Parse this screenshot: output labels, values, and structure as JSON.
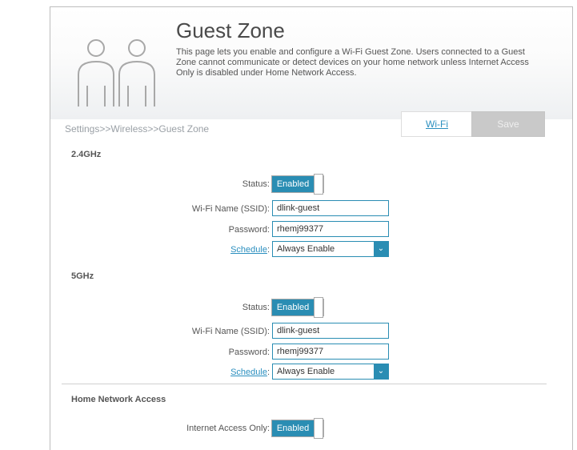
{
  "header": {
    "title": "Guest Zone",
    "description": "This page lets you enable and configure a Wi-Fi Guest Zone. Users connected to a Guest Zone cannot communicate or detect devices on your home network unless Internet Access Only is disabled under Home Network Access."
  },
  "breadcrumb": "Settings>>Wireless>>Guest Zone",
  "toolbar": {
    "wifi_label": "Wi-Fi",
    "save_label": "Save"
  },
  "band_24": {
    "title": "2.4GHz",
    "status_label": "Status:",
    "status_value": "Enabled",
    "ssid_label": "Wi-Fi Name (SSID):",
    "ssid_value": "dlink-guest",
    "password_label": "Password:",
    "password_value": "rhemj99377",
    "schedule_label": "Schedule",
    "schedule_value": "Always Enable"
  },
  "band_5": {
    "title": "5GHz",
    "status_label": "Status:",
    "status_value": "Enabled",
    "ssid_label": "Wi-Fi Name (SSID):",
    "ssid_value": "dlink-guest",
    "password_label": "Password:",
    "password_value": "rhemj99377",
    "schedule_label": "Schedule",
    "schedule_value": "Always Enable"
  },
  "home_network": {
    "title": "Home Network Access",
    "internet_only_label": "Internet Access Only:",
    "internet_only_value": "Enabled"
  },
  "icons": {
    "hero": "two-users-icon",
    "dropdown": "chevron-down-icon"
  },
  "colors": {
    "accent": "#2a8db3",
    "link": "#2b8fbf",
    "save_disabled": "#c9c9c9"
  }
}
